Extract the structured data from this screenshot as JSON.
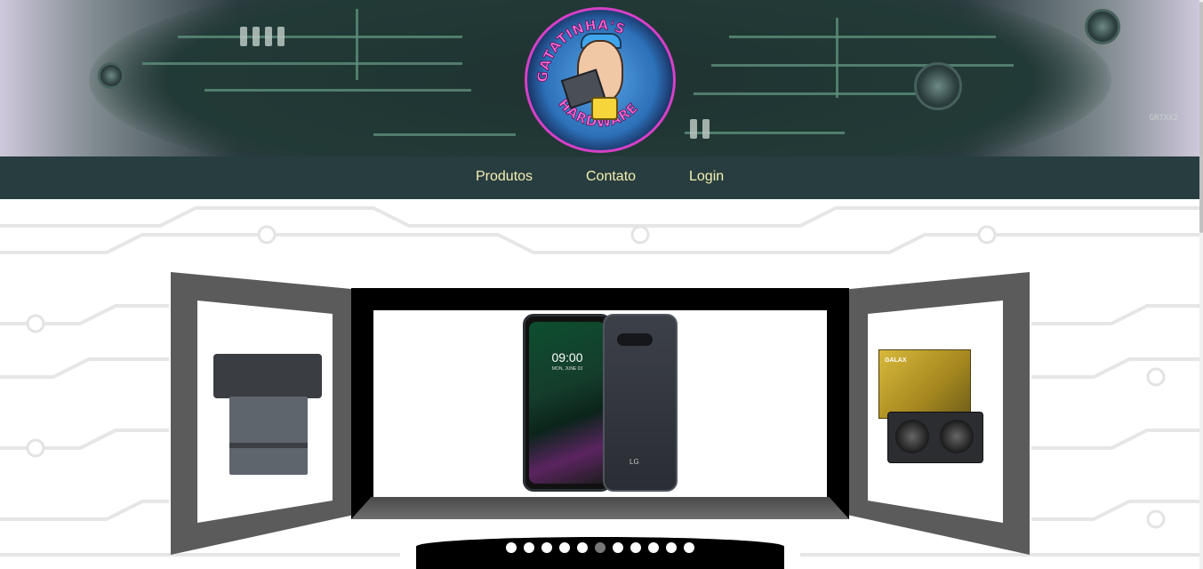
{
  "header": {
    "banner_stamp": "GRTXX2",
    "logo": {
      "ring_text_top": "GATATINHA'S",
      "ring_text_bottom": "HARDWARE"
    }
  },
  "nav": {
    "items": [
      {
        "label": "Produtos"
      },
      {
        "label": "Contato"
      },
      {
        "label": "Login"
      }
    ]
  },
  "carousel": {
    "center_product": {
      "time": "09:00",
      "date": "MON, JUNE 03",
      "brand": "LG"
    },
    "right_product": {
      "box_brand": "GALAX"
    },
    "dots": {
      "count": 11,
      "active_index": 5
    }
  },
  "colors": {
    "nav_bg": "#283d3f",
    "nav_text": "#f4f0b4",
    "panel_gray": "#5b5b5b",
    "dot_active": "#777777"
  }
}
